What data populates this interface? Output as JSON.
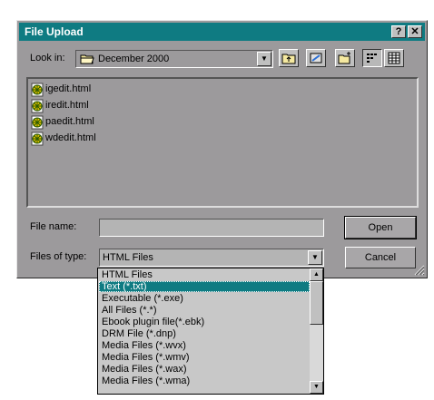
{
  "window": {
    "title": "File Upload",
    "help_button": "?",
    "close_button": "✕"
  },
  "lookin": {
    "label": "Look in:",
    "value": "December 2000"
  },
  "toolbar": {
    "buttons": [
      "up-one-level",
      "desktop",
      "create-new-folder",
      "list-view",
      "details-view"
    ]
  },
  "files": [
    {
      "name": "igedit.html"
    },
    {
      "name": "iredit.html"
    },
    {
      "name": "paedit.html"
    },
    {
      "name": "wdedit.html"
    }
  ],
  "filename": {
    "label": "File name:",
    "value": ""
  },
  "filetype": {
    "label": "Files of type:",
    "value": "HTML Files"
  },
  "buttons": {
    "open": "Open",
    "cancel": "Cancel"
  },
  "dropdown": {
    "selected_index": 1,
    "options": [
      "HTML Files",
      "Text (*.txt)",
      "Executable (*.exe)",
      "All Files (*.*)",
      "Ebook plugin file(*.ebk)",
      "DRM File (*.dnp)",
      "Media Files (*.wvx)",
      "Media Files (*.wmv)",
      "Media Files (*.wax)",
      "Media Files (*.wma)"
    ]
  },
  "colors": {
    "titlebar": "#0f7b82",
    "dialog_face": "#9c9a9c",
    "selection": "#0f7b82"
  }
}
